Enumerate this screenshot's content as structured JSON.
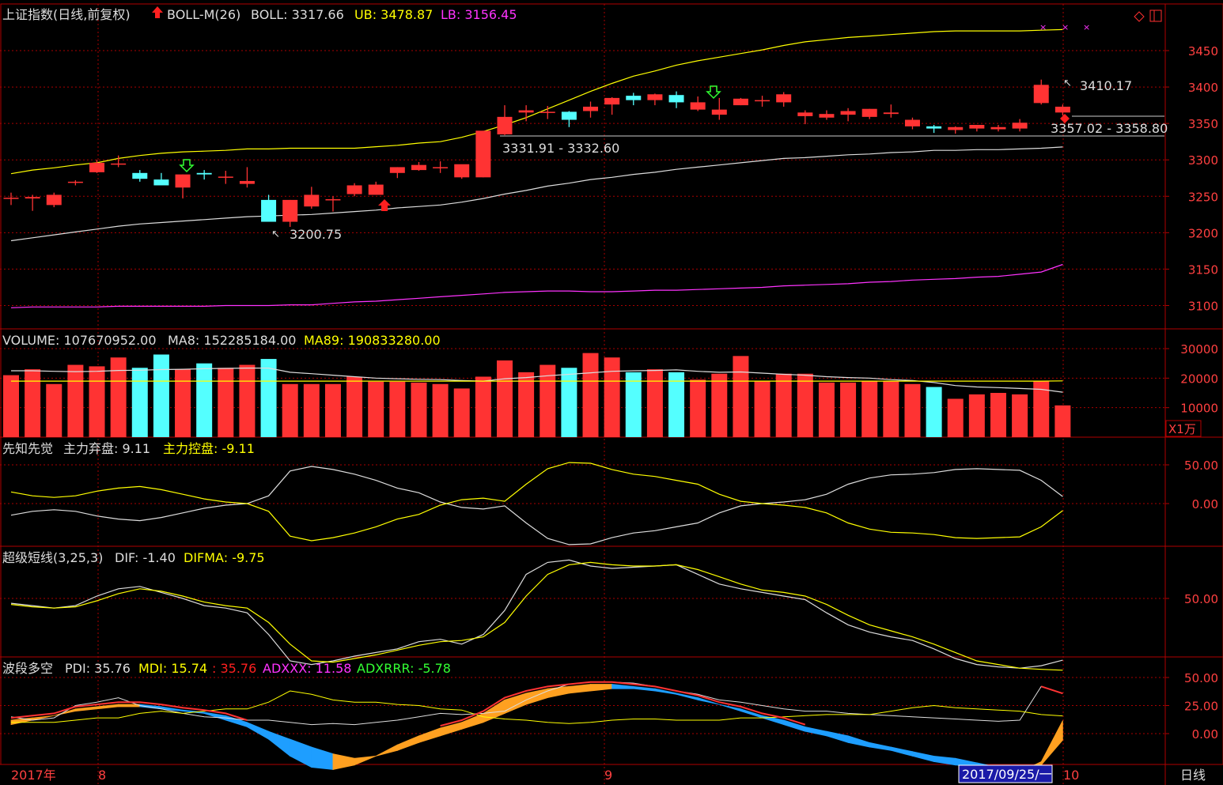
{
  "title_bar": {
    "index_name": "上证指数(日线,前复权)",
    "boll_name": "BOLL-M(26)",
    "boll_label": "BOLL: 3317.66",
    "ub_label": "UB: 3478.87",
    "lb_label": "LB: 3156.45"
  },
  "volume_bar": {
    "name": "VOLUME: 107670952.00",
    "ma8": "MA8: 152285184.00",
    "ma89": "MA89: 190833280.00"
  },
  "xzxj_bar": {
    "name": "先知先觉",
    "a": "主力弃盘: 9.11",
    "b": "主力控盘: -9.11"
  },
  "cjdx_bar": {
    "name": "超级短线(3,25,3)",
    "a": "DIF: -1.40",
    "b": "DIFMA: -9.75"
  },
  "bddk_bar": {
    "name": "波段多空",
    "pdi": "PDI: 35.76",
    "mdi": "MDI: 15.74",
    "c": ": 35.76",
    "adxxx": "ADXXX: 11.58",
    "adxrrr": "ADXRRR: -5.78"
  },
  "axis": {
    "price_ticks": [
      "3450",
      "3400",
      "3350",
      "3300",
      "3250",
      "3200",
      "3150",
      "3100"
    ],
    "vol_ticks": [
      "30000",
      "20000",
      "10000"
    ],
    "vol_unit": "X1万",
    "xzxj_ticks": [
      "50.00",
      "0.00"
    ],
    "cjdx_ticks": [
      "50.00"
    ],
    "bddk_ticks": [
      "50.00",
      "25.00",
      "0.00"
    ],
    "period": "日线"
  },
  "date_axis": {
    "year": "2017年",
    "m8": "8",
    "m9": "9",
    "m10": "10",
    "cursor_date": "2017/09/25/一"
  },
  "annotations": {
    "high": "3410.17",
    "low": "3200.75",
    "gap1": "3331.91 - 3332.60",
    "gap2": "3357.02 - 3358.80"
  },
  "colors": {
    "up": "#ff3333",
    "down": "#54ffff",
    "white": "#dddddd",
    "yellow": "#ffff00",
    "magenta": "#ff33ff",
    "green": "#33ff33",
    "orange": "#ffa020",
    "blue": "#1e9eff",
    "grid": "#aa0000",
    "frame": "#b00000",
    "axis_text": "#ff4040"
  },
  "chart_data": {
    "type": "candlestick",
    "candles_ohlc": [
      [
        3248,
        3255,
        3238,
        3248
      ],
      [
        3247,
        3252,
        3230,
        3249
      ],
      [
        3238,
        3255,
        3235,
        3252
      ],
      [
        3270,
        3272,
        3265,
        3270
      ],
      [
        3283,
        3300,
        3282,
        3296
      ],
      [
        3295,
        3306,
        3290,
        3295
      ],
      [
        3282,
        3286,
        3270,
        3274
      ],
      [
        3273,
        3282,
        3266,
        3265
      ],
      [
        3262,
        3280,
        3247,
        3280
      ],
      [
        3282,
        3286,
        3273,
        3280
      ],
      [
        3277,
        3285,
        3267,
        3277
      ],
      [
        3267,
        3290,
        3262,
        3271
      ],
      [
        3245,
        3252,
        3216,
        3215
      ],
      [
        3215,
        3245,
        3208,
        3245
      ],
      [
        3236,
        3263,
        3233,
        3252
      ],
      [
        3246,
        3250,
        3229,
        3246
      ],
      [
        3253,
        3268,
        3250,
        3265
      ],
      [
        3252,
        3270,
        3253,
        3266
      ],
      [
        3282,
        3290,
        3275,
        3290
      ],
      [
        3286,
        3297,
        3285,
        3293
      ],
      [
        3290,
        3298,
        3282,
        3290
      ],
      [
        3276,
        3290,
        3274,
        3294
      ],
      [
        3276,
        3340,
        3276,
        3340
      ],
      [
        3335,
        3375,
        3334,
        3359
      ],
      [
        3365,
        3375,
        3353,
        3368
      ],
      [
        3366,
        3374,
        3356,
        3366
      ],
      [
        3366,
        3367,
        3345,
        3355
      ],
      [
        3367,
        3380,
        3358,
        3373
      ],
      [
        3376,
        3386,
        3362,
        3385
      ],
      [
        3388,
        3392,
        3375,
        3382
      ],
      [
        3382,
        3391,
        3375,
        3390
      ],
      [
        3389,
        3394,
        3371,
        3379
      ],
      [
        3369,
        3387,
        3367,
        3379
      ],
      [
        3362,
        3385,
        3355,
        3369
      ],
      [
        3375,
        3385,
        3375,
        3384
      ],
      [
        3381,
        3388,
        3373,
        3382
      ],
      [
        3379,
        3393,
        3373,
        3390
      ],
      [
        3360,
        3368,
        3349,
        3365
      ],
      [
        3358,
        3368,
        3355,
        3363
      ],
      [
        3362,
        3371,
        3353,
        3367
      ],
      [
        3359,
        3370,
        3356,
        3370
      ],
      [
        3363,
        3376,
        3358,
        3365
      ],
      [
        3346,
        3358,
        3342,
        3355
      ],
      [
        3346,
        3348,
        3337,
        3343
      ],
      [
        3341,
        3346,
        3336,
        3345
      ],
      [
        3343,
        3347,
        3339,
        3348
      ],
      [
        3342,
        3348,
        3339,
        3345
      ],
      [
        3343,
        3356,
        3339,
        3351
      ],
      [
        3378,
        3410.17,
        3376,
        3403
      ],
      [
        3365,
        3376,
        3361,
        3373
      ]
    ],
    "boll_mid": [
      3189,
      3193,
      3197,
      3201,
      3205,
      3209,
      3212,
      3214,
      3216,
      3218,
      3220,
      3222,
      3223,
      3224,
      3225,
      3227,
      3229,
      3231,
      3234,
      3236,
      3238,
      3242,
      3247,
      3253,
      3258,
      3264,
      3268,
      3273,
      3276,
      3280,
      3283,
      3287,
      3290,
      3293,
      3296,
      3299,
      3302,
      3303,
      3305,
      3307,
      3308,
      3310,
      3311,
      3313,
      3313,
      3314,
      3314,
      3315,
      3316,
      3317.66
    ],
    "boll_ub": [
      3281,
      3286,
      3289,
      3293,
      3296,
      3302,
      3306,
      3309,
      3311,
      3312,
      3313,
      3315,
      3315,
      3316,
      3316,
      3316,
      3316,
      3318,
      3320,
      3323,
      3325,
      3331,
      3339,
      3348,
      3358,
      3370,
      3382,
      3394,
      3405,
      3415,
      3422,
      3430,
      3436,
      3441,
      3446,
      3451,
      3457,
      3462,
      3465,
      3468,
      3470,
      3472,
      3474,
      3476,
      3477,
      3477,
      3477,
      3477,
      3478,
      3478.87
    ],
    "boll_lb": [
      3097,
      3098,
      3098,
      3098,
      3098,
      3099,
      3099,
      3099,
      3099,
      3099,
      3100,
      3100,
      3100,
      3101,
      3101,
      3103,
      3105,
      3106,
      3108,
      3110,
      3112,
      3114,
      3116,
      3118,
      3119,
      3120,
      3120,
      3119,
      3119,
      3120,
      3121,
      3121,
      3122,
      3123,
      3124,
      3125,
      3127,
      3128,
      3129,
      3130,
      3132,
      3133,
      3135,
      3136,
      3137,
      3139,
      3140,
      3143,
      3146,
      3156.45
    ],
    "volume": [
      21000,
      23000,
      18000,
      24500,
      24000,
      27000,
      23500,
      28000,
      23000,
      25000,
      23500,
      24500,
      26500,
      18000,
      18000,
      18000,
      20500,
      18800,
      18800,
      18500,
      18000,
      16500,
      20500,
      26000,
      22000,
      24500,
      23500,
      28500,
      27000,
      22000,
      23000,
      22000,
      19500,
      21500,
      27500,
      19000,
      21500,
      21500,
      18500,
      18500,
      19000,
      19000,
      18000,
      17000,
      13000,
      14500,
      15000,
      14500,
      19000,
      10767
    ],
    "volume_ma8": [
      22500,
      22500,
      22300,
      22200,
      22300,
      22600,
      22700,
      22900,
      23000,
      23200,
      23300,
      23400,
      23400,
      22000,
      21500,
      21000,
      20500,
      20000,
      19800,
      19600,
      19500,
      19200,
      19000,
      19800,
      20200,
      20800,
      21300,
      21800,
      22300,
      22500,
      22600,
      22800,
      22300,
      22000,
      22100,
      21700,
      21300,
      21000,
      20500,
      20200,
      20000,
      19500,
      19200,
      18500,
      17500,
      17000,
      16800,
      16500,
      16200,
      15229
    ],
    "volume_ma89": [
      19000,
      19000,
      19000,
      19000,
      19000,
      19000,
      19000,
      19000,
      19000,
      19000,
      19000,
      19000,
      19000,
      19000,
      19000,
      19000,
      19000,
      19000,
      19000,
      19000,
      19000,
      19000,
      19000,
      19000,
      19000,
      19000,
      19000,
      19000,
      19000,
      19000,
      19000,
      19000,
      19000,
      19000,
      19000,
      19000,
      19000,
      19000,
      19000,
      19000,
      19000,
      19000,
      19000,
      19000,
      19000,
      19000,
      19000,
      19000,
      19000,
      19083
    ],
    "xzxj_a": [
      -15,
      -10,
      -8,
      -10,
      -16,
      -20,
      -22,
      -18,
      -12,
      -6,
      -2,
      0,
      10,
      42,
      48,
      44,
      38,
      30,
      20,
      14,
      2,
      -5,
      -7,
      -3,
      -25,
      -45,
      -53,
      -52,
      -44,
      -38,
      -35,
      -30,
      -25,
      -12,
      -3,
      0,
      2,
      5,
      12,
      25,
      33,
      37,
      38,
      40,
      44,
      45,
      44,
      43,
      30,
      9.11
    ],
    "xzxj_b": [
      15,
      10,
      8,
      10,
      16,
      20,
      22,
      18,
      12,
      6,
      2,
      0,
      -10,
      -42,
      -48,
      -44,
      -38,
      -30,
      -20,
      -14,
      -2,
      5,
      7,
      3,
      25,
      45,
      53,
      52,
      44,
      38,
      35,
      30,
      25,
      12,
      3,
      0,
      -2,
      -5,
      -12,
      -25,
      -33,
      -37,
      -38,
      -40,
      -44,
      -45,
      -44,
      -43,
      -30,
      -9.11
    ],
    "cjdx_a": [
      46,
      44,
      42,
      44,
      52,
      58,
      60,
      55,
      50,
      44,
      42,
      38,
      20,
      -2,
      -5,
      -2,
      2,
      5,
      8,
      14,
      16,
      12,
      20,
      40,
      70,
      80,
      82,
      77,
      75,
      76,
      77,
      78,
      70,
      62,
      58,
      55,
      52,
      49,
      38,
      28,
      22,
      18,
      15,
      8,
      0,
      -5,
      -7,
      -8,
      -6,
      -1.4
    ],
    "cjdx_b": [
      45,
      43,
      42,
      43,
      48,
      54,
      58,
      56,
      52,
      47,
      44,
      42,
      30,
      12,
      -2,
      -3,
      0,
      3,
      7,
      11,
      14,
      15,
      18,
      30,
      52,
      70,
      78,
      80,
      78,
      77,
      77,
      78,
      74,
      68,
      62,
      57,
      55,
      52,
      45,
      36,
      28,
      23,
      18,
      12,
      5,
      -2,
      -5,
      -8,
      -9,
      -9.75
    ],
    "pdi": [
      15,
      12,
      14,
      25,
      28,
      32,
      25,
      22,
      18,
      15,
      14,
      12,
      12,
      10,
      8,
      9,
      8,
      10,
      12,
      15,
      18,
      17,
      18,
      20,
      30,
      38,
      44,
      46,
      46,
      45,
      42,
      38,
      35,
      30,
      28,
      25,
      22,
      20,
      20,
      18,
      17,
      16,
      15,
      14,
      13,
      12,
      11,
      12,
      42,
      35.76
    ],
    "mdi": [
      10,
      10,
      10,
      12,
      14,
      14,
      18,
      20,
      18,
      20,
      22,
      22,
      28,
      38,
      35,
      30,
      28,
      28,
      26,
      25,
      22,
      21,
      15,
      13,
      12,
      10,
      9,
      10,
      12,
      13,
      13,
      12,
      12,
      12,
      14,
      14,
      15,
      16,
      17,
      17,
      17,
      20,
      23,
      25,
      23,
      22,
      21,
      20,
      17,
      15.74
    ],
    "adxxx": [
      12,
      14,
      16,
      20,
      22,
      24,
      24,
      22,
      20,
      18,
      12,
      6,
      -5,
      -20,
      -30,
      -32,
      -28,
      -20,
      -10,
      -2,
      5,
      10,
      18,
      30,
      36,
      40,
      42,
      44,
      44,
      42,
      40,
      36,
      32,
      26,
      20,
      14,
      8,
      2,
      -2,
      -8,
      -12,
      -15,
      -20,
      -25,
      -28,
      -30,
      -32,
      -34,
      -25,
      11.58
    ],
    "adxrrr": [
      8,
      12,
      16,
      22,
      24,
      26,
      26,
      24,
      21,
      19,
      16,
      10,
      2,
      -5,
      -12,
      -18,
      -22,
      -20,
      -15,
      -8,
      -2,
      4,
      10,
      18,
      26,
      32,
      36,
      38,
      40,
      40,
      38,
      35,
      30,
      26,
      22,
      16,
      12,
      6,
      2,
      -2,
      -8,
      -12,
      -16,
      -20,
      -22,
      -26,
      -30,
      -32,
      -28,
      -5.78
    ]
  }
}
